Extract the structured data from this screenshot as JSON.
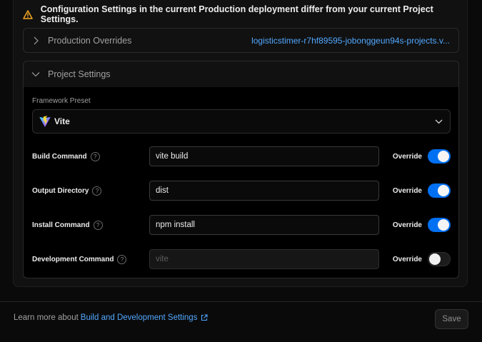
{
  "warning": {
    "text": "Configuration Settings in the current Production deployment differ from your current Project Settings.",
    "icon": "warning-triangle-icon",
    "color": "#f5a623"
  },
  "production_overrides": {
    "title": "Production Overrides",
    "link": "logisticstimer-r7hf89595-jobonggeun94s-projects.v..."
  },
  "project_settings": {
    "title": "Project Settings",
    "framework_preset": {
      "label": "Framework Preset",
      "value": "Vite"
    },
    "fields": [
      {
        "label": "Build Command",
        "value": "vite build",
        "placeholder": "",
        "override_label": "Override",
        "override": true
      },
      {
        "label": "Output Directory",
        "value": "dist",
        "placeholder": "",
        "override_label": "Override",
        "override": true
      },
      {
        "label": "Install Command",
        "value": "npm install",
        "placeholder": "",
        "override_label": "Override",
        "override": true
      },
      {
        "label": "Development Command",
        "value": "",
        "placeholder": "vite",
        "override_label": "Override",
        "override": false
      }
    ],
    "help_glyph": "?"
  },
  "footer": {
    "learn_prefix": "Learn more about",
    "learn_link": "Build and Development Settings",
    "save_label": "Save"
  },
  "colors": {
    "accent": "#0070f3",
    "link": "#52a8ff",
    "warning": "#f5a623"
  }
}
